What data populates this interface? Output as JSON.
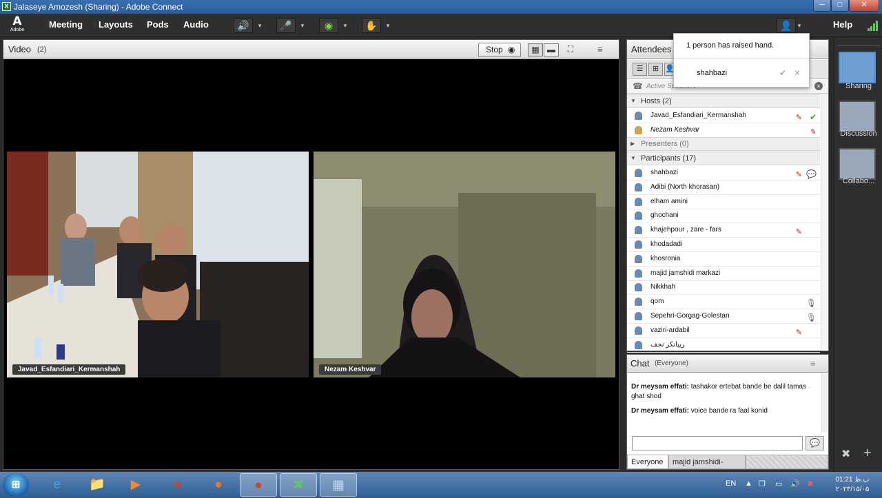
{
  "window": {
    "title": "Jalaseye Amozesh (Sharing) - Adobe Connect",
    "app_icon": "connect-app-icon",
    "min": "─",
    "max": "□",
    "close": "✕"
  },
  "menubar": {
    "logo_letter": "A",
    "logo_text": "Adobe",
    "items": [
      "Meeting",
      "Layouts",
      "Pods",
      "Audio"
    ],
    "help": "Help",
    "speaker_icon": "🔊",
    "mic_icon": "🎤",
    "cam_icon": "◉",
    "hand_icon": "✋",
    "drop": "▾",
    "status_icon": "👤"
  },
  "video": {
    "title": "Video",
    "count": "(2)",
    "stop_label": "Stop",
    "cam_glyph": "◉",
    "grid_glyph": "▦",
    "single_glyph": "▬",
    "fullscreen_glyph": "⛶",
    "menu_glyph": "≡",
    "tiles": [
      {
        "label": "Javad_Esfandiari_Kermanshah"
      },
      {
        "label": "Nezam Keshvar"
      }
    ]
  },
  "attendees": {
    "title": "Attendees",
    "active_speakers": "Active Speakers",
    "tool_glyphs": [
      "☰",
      "⊞",
      "👤"
    ],
    "phone_glyph": "☎",
    "close_glyph": "×",
    "collapse_glyph": "▼",
    "expand_glyph": "▶",
    "hosts": {
      "label": "Hosts (2)",
      "rows": [
        {
          "name": "Javad_Esfandiari_Kermanshah",
          "mic": "✎",
          "status": "✔"
        },
        {
          "name": "Nezam Keshvar",
          "mic": "✎",
          "status": ""
        }
      ]
    },
    "presenters": {
      "label": "Presenters (0)"
    },
    "participants": {
      "label": "Participants (17)",
      "rows": [
        {
          "name": "shahbazi",
          "mic": "✎",
          "status": "💬"
        },
        {
          "name": "Adibi (North khorasan)",
          "mic": "",
          "status": ""
        },
        {
          "name": "elham amini",
          "mic": "",
          "status": ""
        },
        {
          "name": "ghochani",
          "mic": "",
          "status": ""
        },
        {
          "name": "khajehpour , zare - fars",
          "mic": "✎",
          "status": ""
        },
        {
          "name": "khodadadi",
          "mic": "",
          "status": ""
        },
        {
          "name": "khosronia",
          "mic": "",
          "status": ""
        },
        {
          "name": "majid jamshidi markazi",
          "mic": "",
          "status": ""
        },
        {
          "name": "Nikkhah",
          "mic": "",
          "status": ""
        },
        {
          "name": "qom",
          "mic": "",
          "status": "🎙"
        },
        {
          "name": "Sepehri-Gorgag-Golestan",
          "mic": "",
          "status": "🎙"
        },
        {
          "name": "vaziri-ardabil",
          "mic": "✎",
          "status": ""
        },
        {
          "name": "رییانکر نجف",
          "mic": "",
          "status": ""
        }
      ]
    }
  },
  "raised_hand": {
    "message": "1 person has raised hand.",
    "name": "shahbazi",
    "accept": "✔",
    "dismiss": "✕"
  },
  "chat": {
    "title": "Chat",
    "scope": "(Everyone)",
    "messages": [
      {
        "sender": "Dr meysam effati:",
        "text": " tashakor ertebat bande be dalil tamas ghat shod"
      },
      {
        "sender": "Dr meysam effati:",
        "text": " voice bande ra faal konid"
      }
    ],
    "input_placeholder": "",
    "send_glyph": "💬",
    "tabs": [
      "Everyone",
      "majid jamshidi-mar..."
    ],
    "menu_glyph": "≡"
  },
  "layouts": {
    "items": [
      "Sharing",
      "Discussion",
      "Collabo..."
    ],
    "tools": [
      "✖",
      "+"
    ]
  },
  "taskbar": {
    "start_glyph": "⊞",
    "apps": [
      {
        "name": "internet-explorer",
        "glyph": "e",
        "color": "#3ea1f0"
      },
      {
        "name": "file-explorer",
        "glyph": "📁",
        "color": "#f3c34a"
      },
      {
        "name": "media-player",
        "glyph": "▶",
        "color": "#f08a2a"
      },
      {
        "name": "chrome",
        "glyph": "●",
        "color": "#d9412f"
      },
      {
        "name": "firefox",
        "glyph": "●",
        "color": "#f07a1a"
      },
      {
        "name": "chrome-2",
        "glyph": "●",
        "color": "#d9412f"
      },
      {
        "name": "adobe-connect",
        "glyph": "✖",
        "color": "#5ec95e"
      },
      {
        "name": "control-panel",
        "glyph": "▦",
        "color": "#bcd6f0"
      }
    ],
    "lang": "EN",
    "time": "01:21 ب.ظ",
    "date": "۲۰۲۳/۱۵/۰۵",
    "tray_glyphs": [
      "▲",
      "❐",
      "▭",
      "🔊",
      "✖"
    ]
  }
}
